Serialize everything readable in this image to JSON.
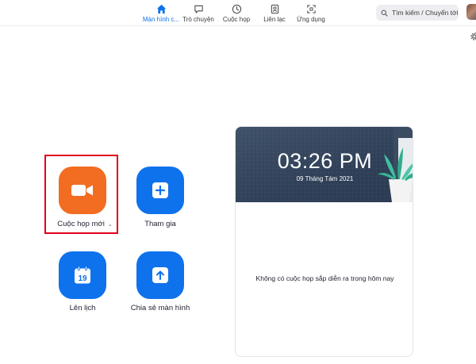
{
  "nav": {
    "items": [
      {
        "id": "home",
        "label": "Màn hình c...",
        "icon": "home-icon",
        "active": true
      },
      {
        "id": "chat",
        "label": "Trò chuyện",
        "icon": "chat-bubble-icon",
        "active": false
      },
      {
        "id": "meetings",
        "label": "Cuộc họp",
        "icon": "clock-icon",
        "active": false
      },
      {
        "id": "contacts",
        "label": "Liên lạc",
        "icon": "contact-icon",
        "active": false
      },
      {
        "id": "apps",
        "label": "Ứng dụng",
        "icon": "apps-icon",
        "active": false
      }
    ]
  },
  "search": {
    "label": "Tìm kiếm / Chuyển tới",
    "icon": "search-icon"
  },
  "actions": {
    "new_meeting": {
      "label": "Cuộc họp mới",
      "icon": "video-camera-icon",
      "dropdown_icon": "chevron-down-icon"
    },
    "join": {
      "label": "Tham gia",
      "icon": "plus-icon"
    },
    "schedule": {
      "label": "Lên lịch",
      "icon": "calendar-icon",
      "calendar_day": "19"
    },
    "share_screen": {
      "label": "Chia sẻ màn hình",
      "icon": "share-arrow-icon"
    }
  },
  "calendar_card": {
    "time": "03:26 PM",
    "date": "09 Tháng Tám 2021",
    "empty_message": "Không có cuộc họp sắp diễn ra trong hôm nay"
  },
  "colors": {
    "accent": "#0e72ed",
    "new_meeting": "#f26d21",
    "highlight_border": "#e2001a",
    "card_header": "#2f4058"
  }
}
